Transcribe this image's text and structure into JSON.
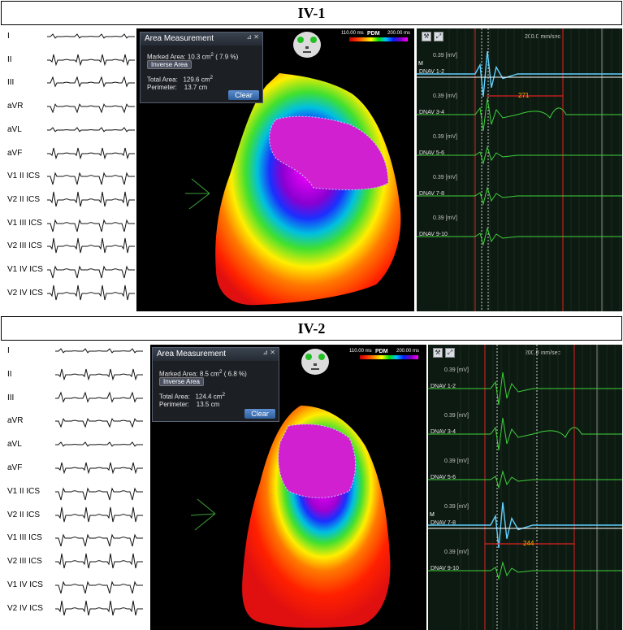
{
  "panels": [
    {
      "id": "IV-1",
      "title": "IV-1",
      "leads": [
        "I",
        "II",
        "III",
        "aVR",
        "aVL",
        "aVF",
        "V1 II ICS",
        "V2 II ICS",
        "V1 III ICS",
        "V2 III ICS",
        "V1 IV ICS",
        "V2 IV ICS"
      ],
      "area_measurement": {
        "title": "Area Measurement",
        "marked_area_label": "Marked Area:",
        "marked_area_value": "10.3",
        "area_unit": "cm",
        "marked_area_percent": "7.9",
        "percent_symbol": "%)",
        "inverse_area_label": "Inverse Area",
        "total_area_label": "Total Area:",
        "total_area_value": "129.6",
        "perimeter_label": "Perimeter:",
        "perimeter_value": "13.7",
        "perimeter_unit": "cm",
        "clear_label": "Clear"
      },
      "pdm_legend": {
        "min": "110.00 ms",
        "label": "PDM",
        "max": "200.00 ms"
      },
      "egm": {
        "speed": "200.0 mm/sec",
        "scale": "0.39  [mV]",
        "marker": "M",
        "interval": "271",
        "channels": [
          "DNAV 1-2",
          "DNAV 3-4",
          "DNAV 5-6",
          "DNAV 7-8",
          "DNAV 9-10"
        ],
        "highlighted_channel": "DNAV 1-2"
      }
    },
    {
      "id": "IV-2",
      "title": "IV-2",
      "leads": [
        "I",
        "II",
        "III",
        "aVR",
        "aVL",
        "aVF",
        "V1 II ICS",
        "V2 II ICS",
        "V1 III ICS",
        "V2 III ICS",
        "V1 IV ICS",
        "V2 IV ICS"
      ],
      "area_measurement": {
        "title": "Area Measurement",
        "marked_area_label": "Marked Area:",
        "marked_area_value": "8.5",
        "area_unit": "cm",
        "marked_area_percent": "6.8",
        "percent_symbol": "%)",
        "inverse_area_label": "Inverse Area",
        "total_area_label": "Total Area:",
        "total_area_value": "124.4",
        "perimeter_label": "Perimeter:",
        "perimeter_value": "13.5",
        "perimeter_unit": "cm",
        "clear_label": "Clear"
      },
      "pdm_legend": {
        "min": "110.00 ms",
        "label": "PDM",
        "max": "200.00 ms"
      },
      "egm": {
        "speed": "200.0 mm/sec",
        "scale": "0.39  [mV]",
        "marker": "M",
        "interval": "244",
        "channels": [
          "DNAV 1-2",
          "DNAV 3-4",
          "DNAV 5-6",
          "DNAV 7-8",
          "DNAV 9-10"
        ],
        "highlighted_channel": "DNAV 7-8"
      }
    }
  ],
  "colors": {
    "map_background": "#000000",
    "egm_background": "#0d1a12",
    "egm_trace": "#3fd13a",
    "egm_highlight": "#5fd0ff",
    "marker_line": "#e02020",
    "interval_text": "#ffb000",
    "clear_button": "#3a72b8"
  },
  "icons": {
    "face": "head-orientation-icon",
    "axes": "orientation-axes-icon",
    "tools": [
      "caliper-tool-icon",
      "zoom-tool-icon"
    ],
    "window_controls": [
      "pin-icon",
      "close-icon"
    ]
  }
}
